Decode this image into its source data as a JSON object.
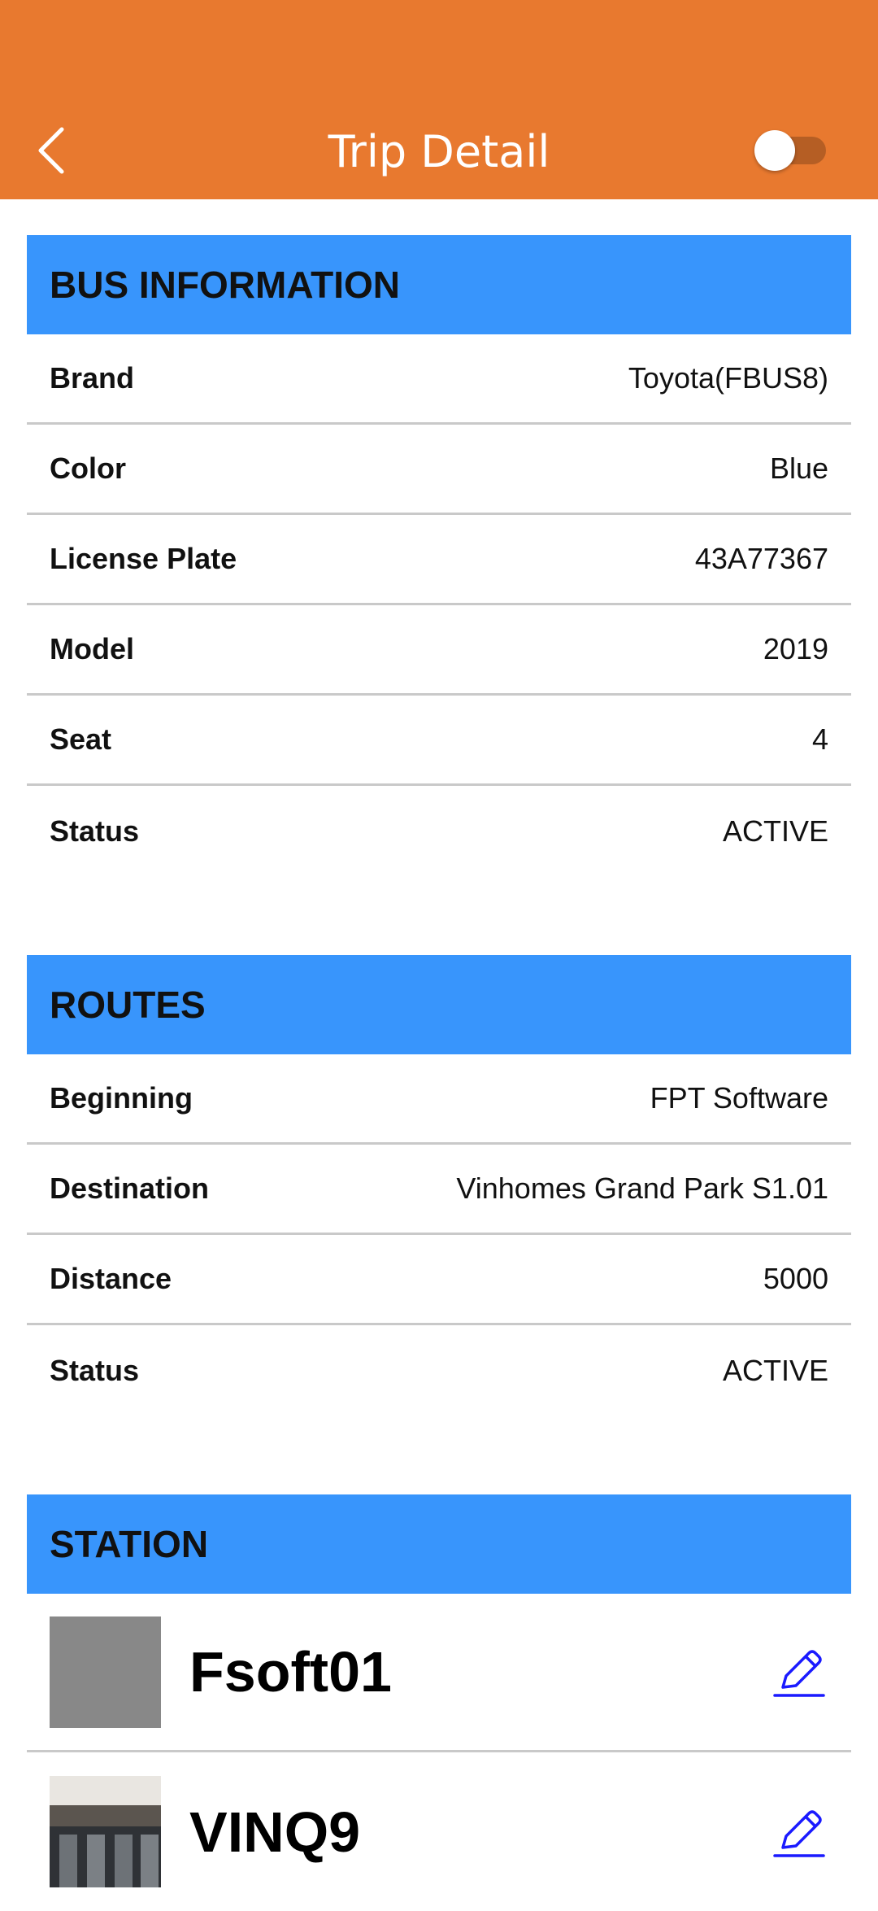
{
  "header": {
    "title": "Trip Detail",
    "back_icon": "chevron-left-icon",
    "toggle_on": false,
    "background_color": "#E8792F"
  },
  "bus_information": {
    "title": "BUS INFORMATION",
    "rows": [
      {
        "label": "Brand",
        "value": "Toyota(FBUS8)"
      },
      {
        "label": "Color",
        "value": "Blue"
      },
      {
        "label": "License Plate",
        "value": "43A77367"
      },
      {
        "label": "Model",
        "value": "2019"
      },
      {
        "label": "Seat",
        "value": "4"
      },
      {
        "label": "Status",
        "value": "ACTIVE"
      }
    ]
  },
  "routes": {
    "title": "ROUTES",
    "rows": [
      {
        "label": "Beginning",
        "value": "FPT Software"
      },
      {
        "label": "Destination",
        "value": "Vinhomes Grand Park S1.01"
      },
      {
        "label": "Distance",
        "value": "5000"
      },
      {
        "label": "Status",
        "value": "ACTIVE"
      }
    ]
  },
  "station": {
    "title": "STATION",
    "items": [
      {
        "name": "Fsoft01",
        "edit_icon": "pencil-icon"
      },
      {
        "name": "VINQ9",
        "edit_icon": "pencil-icon"
      }
    ]
  },
  "colors": {
    "section_header": "#3895FC",
    "edit_icon": "#1a1aff"
  }
}
